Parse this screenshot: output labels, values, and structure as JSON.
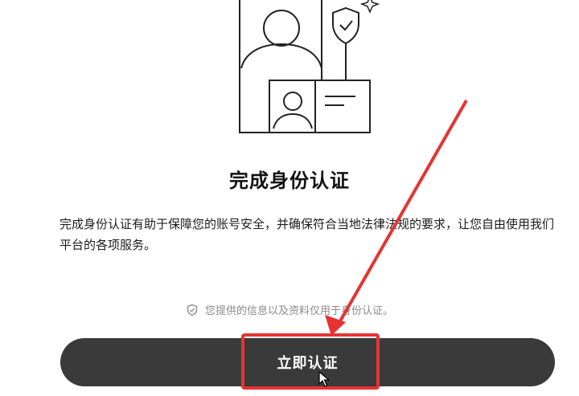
{
  "verification": {
    "title": "完成身份认证",
    "description": "完成身份认证有助于保障您的账号安全，并确保符合当地法律法规的要求，让您自由使用我们平台的各项服务。",
    "privacy_note": "您提供的信息以及资料仅用于身份认证。",
    "primary_button_label": "立即认证"
  },
  "icons": {
    "illustration": "id-verification-illustration",
    "privacy": "shield-check-icon",
    "cursor": "mouse-pointer-icon"
  },
  "colors": {
    "button_bg": "#3a3a3a",
    "annotation_red": "#e53333",
    "muted_text": "#8a8a8a"
  }
}
